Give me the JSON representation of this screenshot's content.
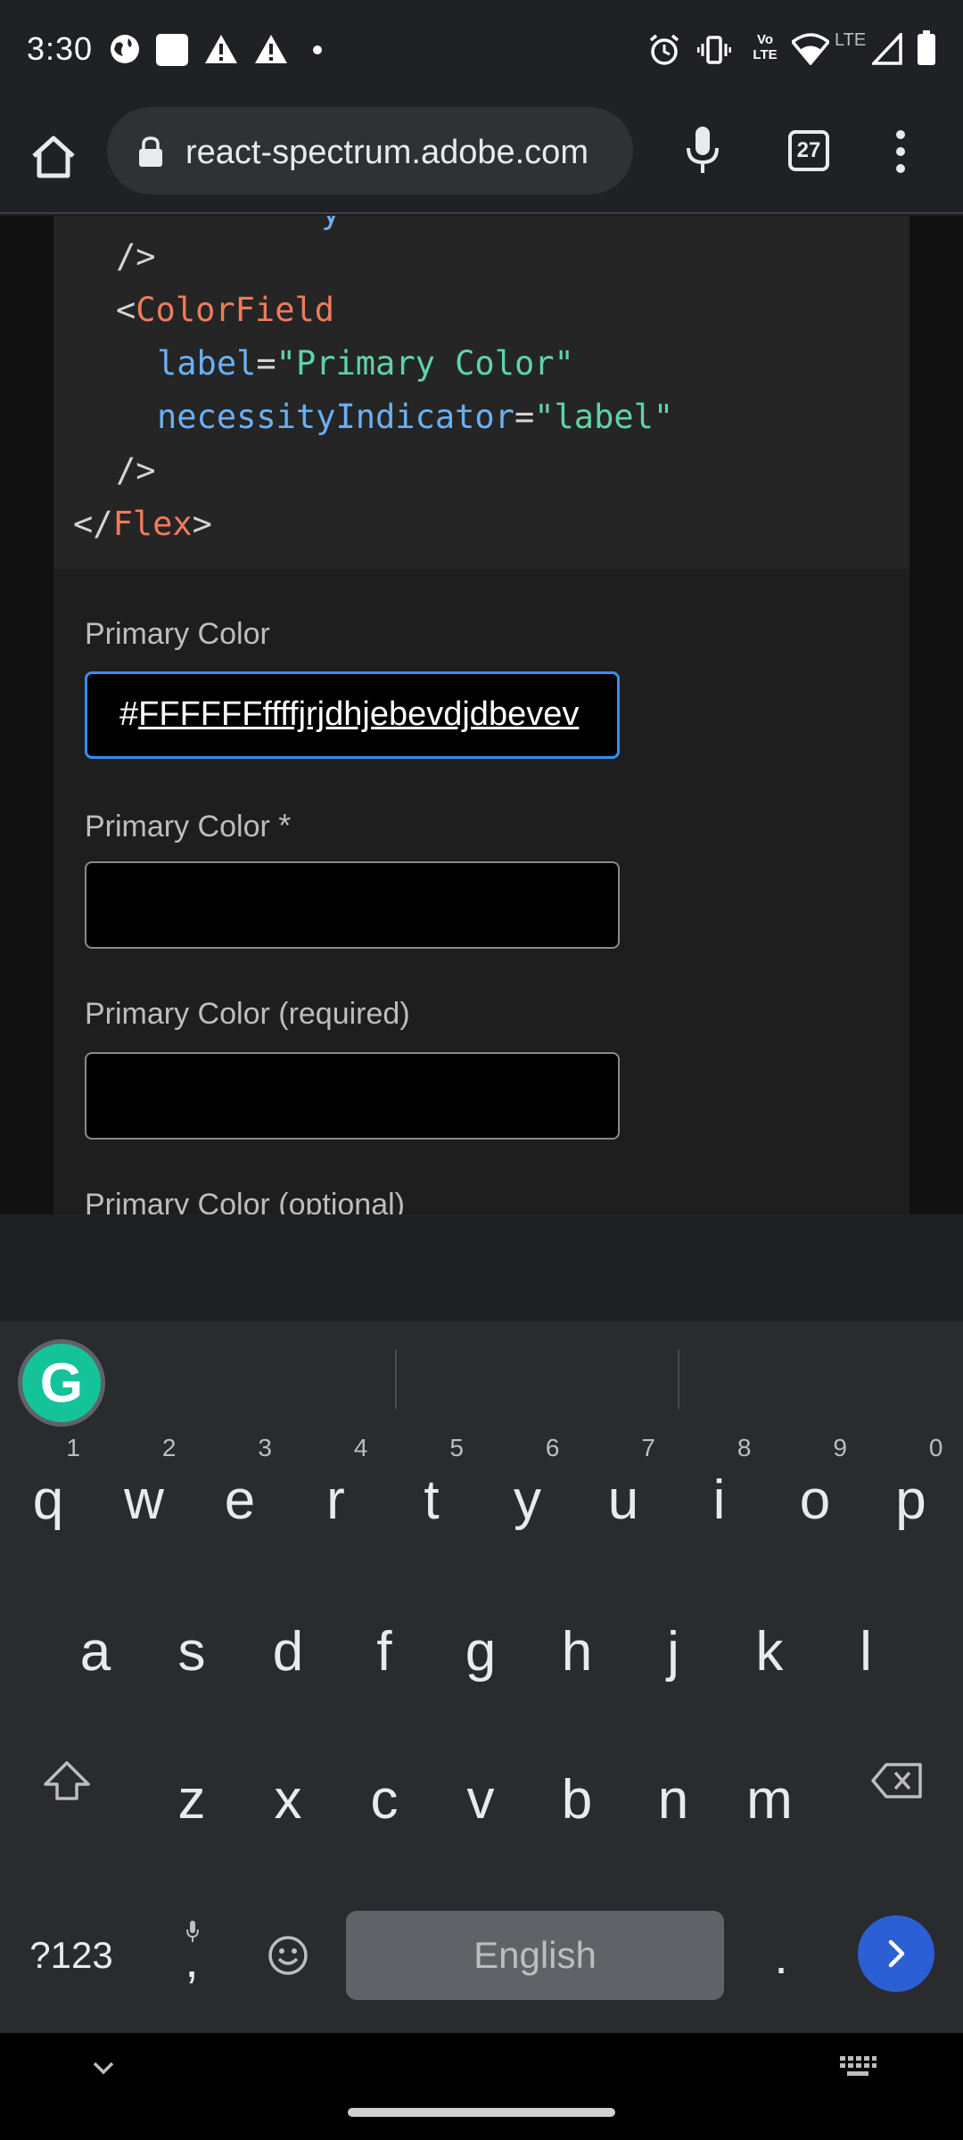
{
  "status_bar": {
    "time": "3:30",
    "icons_left": [
      "globe-icon",
      "square-notification-icon",
      "warning-icon",
      "warning-icon",
      "dot-icon"
    ],
    "lte_label": "LTE",
    "volte_label": "Vo LTE"
  },
  "browser": {
    "url": "react-spectrum.adobe.com",
    "tab_count": "27"
  },
  "code": {
    "line_self_close_1": "/>",
    "line_open_lt": "<",
    "component_name": "ColorField",
    "attr1_name": "label",
    "attr1_eq": "=",
    "attr1_value": "\"Primary Color\"",
    "attr2_name": "necessityIndicator",
    "attr2_eq": "=",
    "attr2_value": "\"label\"",
    "line_self_close_2": "/>",
    "close_prefix": "</",
    "close_name": "Flex",
    "close_suffix": ">"
  },
  "fields": [
    {
      "label": "Primary Color",
      "value_prefix": "#",
      "value_underlined": "FFFFFFffffjrjdhjebevdjdbevev",
      "focused": true
    },
    {
      "label": "Primary Color",
      "required_marker": "*",
      "value": ""
    },
    {
      "label": "Primary Color (required)",
      "value": ""
    },
    {
      "label": "Primary Color (optional)"
    }
  ],
  "keyboard": {
    "row1": [
      {
        "letter": "q",
        "num": "1"
      },
      {
        "letter": "w",
        "num": "2"
      },
      {
        "letter": "e",
        "num": "3"
      },
      {
        "letter": "r",
        "num": "4"
      },
      {
        "letter": "t",
        "num": "5"
      },
      {
        "letter": "y",
        "num": "6"
      },
      {
        "letter": "u",
        "num": "7"
      },
      {
        "letter": "i",
        "num": "8"
      },
      {
        "letter": "o",
        "num": "9"
      },
      {
        "letter": "p",
        "num": "0"
      }
    ],
    "row2": [
      "a",
      "s",
      "d",
      "f",
      "g",
      "h",
      "j",
      "k",
      "l"
    ],
    "row3": [
      "z",
      "x",
      "c",
      "v",
      "b",
      "n",
      "m"
    ],
    "symbols_label": "?123",
    "comma_label": ",",
    "space_label": "English",
    "period_label": ".",
    "grammarly_label": "G"
  },
  "colors": {
    "accent_blue": "#378ef0",
    "code_tag": "#f07b5b",
    "code_attr": "#6ab0f3",
    "code_string": "#5fd3a8",
    "enter_key": "#2c5fd4",
    "grammarly": "#15c39a"
  }
}
